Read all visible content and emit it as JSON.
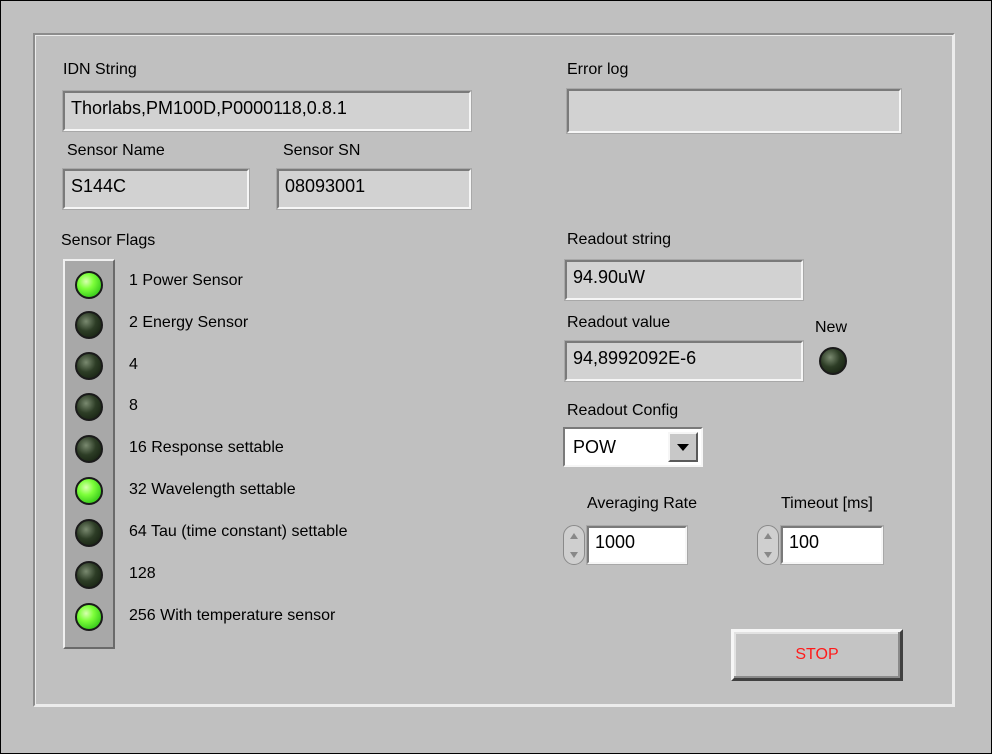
{
  "idn": {
    "label": "IDN String",
    "value": "Thorlabs,PM100D,P0000118,0.8.1"
  },
  "error_log": {
    "label": "Error log",
    "value": ""
  },
  "sensor_name": {
    "label": "Sensor Name",
    "value": "S144C"
  },
  "sensor_sn": {
    "label": "Sensor SN",
    "value": "08093001"
  },
  "sensor_flags": {
    "label": "Sensor Flags",
    "items": [
      {
        "label": "1 Power Sensor",
        "on": true
      },
      {
        "label": "2 Energy Sensor",
        "on": false
      },
      {
        "label": "4",
        "on": false
      },
      {
        "label": "8",
        "on": false
      },
      {
        "label": "16 Response settable",
        "on": false
      },
      {
        "label": "32 Wavelength settable",
        "on": true
      },
      {
        "label": "64 Tau (time constant) settable",
        "on": false
      },
      {
        "label": "128",
        "on": false
      },
      {
        "label": "256 With temperature sensor",
        "on": true
      }
    ]
  },
  "readout_string": {
    "label": "Readout string",
    "value": "94.90uW"
  },
  "readout_value": {
    "label": "Readout value",
    "value": "94,8992092E-6"
  },
  "new_indicator": {
    "label": "New",
    "on": false
  },
  "readout_config": {
    "label": "Readout Config",
    "value": "POW"
  },
  "averaging_rate": {
    "label": "Averaging Rate",
    "value": "1000"
  },
  "timeout": {
    "label": "Timeout [ms]",
    "value": "100"
  },
  "stop": {
    "label": "STOP",
    "color": "#ff1a1a"
  },
  "colors": {
    "background": "#c0c0c0",
    "led_on": "#7dff3a",
    "led_off": "#2d3d26"
  }
}
